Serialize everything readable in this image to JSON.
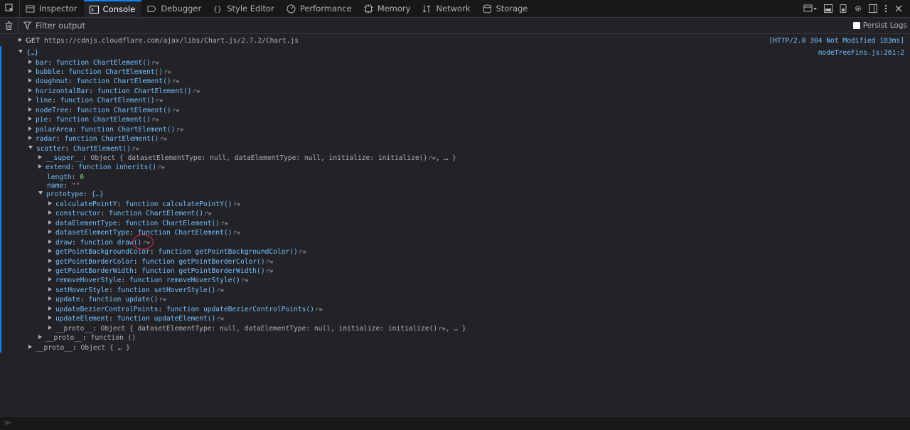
{
  "toolbar": {
    "tabs": [
      {
        "label": "Inspector",
        "icon": "inspector-icon"
      },
      {
        "label": "Console",
        "icon": "console-icon",
        "selected": true
      },
      {
        "label": "Debugger",
        "icon": "debugger-icon"
      },
      {
        "label": "Style Editor",
        "icon": "style-editor-icon"
      },
      {
        "label": "Performance",
        "icon": "performance-icon"
      },
      {
        "label": "Memory",
        "icon": "memory-icon"
      },
      {
        "label": "Network",
        "icon": "network-icon"
      },
      {
        "label": "Storage",
        "icon": "storage-icon"
      }
    ]
  },
  "filterbar": {
    "placeholder": "Filter output",
    "persist_logs": "Persist Logs"
  },
  "console": {
    "network": {
      "method": "GET",
      "url": "https://cdnjs.cloudflare.com/ajax/libs/Chart.js/2.7.2/Chart.js",
      "status": "[HTTP/2.0 304 Not Modified 183ms]"
    },
    "object_root": "{…}",
    "location": "nodeTreeFins.js:261:2",
    "top_entries": [
      {
        "key": "bar",
        "fn": "ChartElement()"
      },
      {
        "key": "bubble",
        "fn": "ChartElement()"
      },
      {
        "key": "doughnut",
        "fn": "ChartElement()"
      },
      {
        "key": "horizontalBar",
        "fn": "ChartElement()"
      },
      {
        "key": "line",
        "fn": "ChartElement()"
      },
      {
        "key": "nodeTree",
        "fn": "ChartElement()"
      },
      {
        "key": "pie",
        "fn": "ChartElement()"
      },
      {
        "key": "polarArea",
        "fn": "ChartElement()"
      },
      {
        "key": "radar",
        "fn": "ChartElement()"
      }
    ],
    "scatter": {
      "key": "scatter",
      "value": "ChartElement()",
      "super_key": "__super__",
      "super_value": "Object { datasetElementType: null, dataElementType: null, initialize: initialize()",
      "super_tail": ", … }",
      "extend_key": "extend",
      "extend_fn": "inherits()",
      "length_key": "length",
      "length_value": "0",
      "name_key": "name",
      "name_value": "\"\"",
      "prototype_key": "prototype",
      "prototype_value": "{…}"
    },
    "prototype_entries": [
      {
        "key": "calculatePointY",
        "fn": "calculatePointY()"
      },
      {
        "key": "constructor",
        "fn": "ChartElement()"
      },
      {
        "key": "dataElementType",
        "fn": "ChartElement()"
      },
      {
        "key": "datasetElementType",
        "fn": "ChartElement()"
      },
      {
        "key": "draw",
        "fn": "draw()"
      },
      {
        "key": "getPointBackgroundColor",
        "fn": "getPointBackgroundColor()"
      },
      {
        "key": "getPointBorderColor",
        "fn": "getPointBorderColor()"
      },
      {
        "key": "getPointBorderWidth",
        "fn": "getPointBorderWidth()"
      },
      {
        "key": "removeHoverStyle",
        "fn": "removeHoverStyle()"
      },
      {
        "key": "setHoverStyle",
        "fn": "setHoverStyle()"
      },
      {
        "key": "update",
        "fn": "update()"
      },
      {
        "key": "updateBezierControlPoints",
        "fn": "updateBezierControlPoints()"
      },
      {
        "key": "updateElement",
        "fn": "updateElement()"
      }
    ],
    "prototype_proto": {
      "key": "__proto__",
      "value": "Object { datasetElementType: null, dataElementType: null, initialize: initialize()",
      "tail": ", … }"
    },
    "scatter_proto": {
      "key": "__proto__",
      "value": "function ()"
    },
    "root_proto": {
      "key": "__proto__",
      "value": "Object { … }"
    },
    "keyword_function": "function"
  },
  "colors": {
    "accent": "#0a84ff",
    "highlight_circle": "#e22850"
  }
}
